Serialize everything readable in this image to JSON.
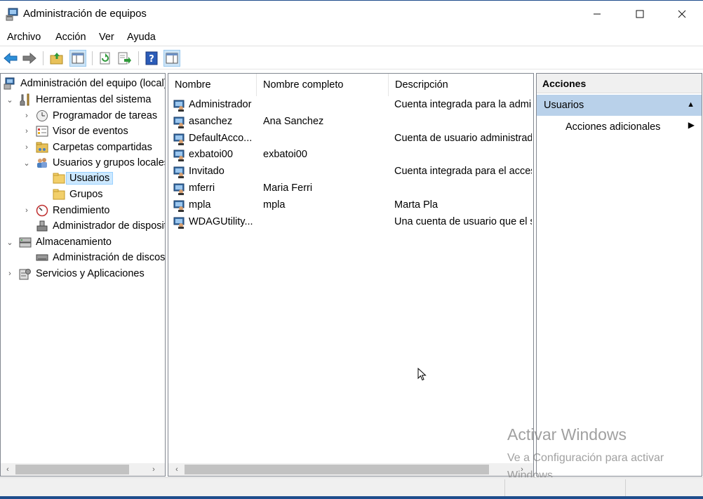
{
  "window": {
    "title": "Administración de equipos",
    "controls": {
      "minimize": "—",
      "maximize": "☐",
      "close": "✕"
    }
  },
  "menu": [
    "Archivo",
    "Acción",
    "Ver",
    "Ayuda"
  ],
  "toolbar": {
    "buttons": [
      "back-icon",
      "forward-icon",
      "up-folder-icon",
      "show-hide-tree-icon",
      "refresh-icon",
      "export-list-icon",
      "help-icon",
      "show-hide-action-pane-icon"
    ]
  },
  "tree": {
    "root": "Administración del equipo (local)",
    "system_tools": "Herramientas del sistema",
    "task_scheduler": "Programador de tareas",
    "event_viewer": "Visor de eventos",
    "shared_folders": "Carpetas compartidas",
    "local_users_groups": "Usuarios y grupos locales",
    "users": "Usuarios",
    "groups": "Grupos",
    "performance": "Rendimiento",
    "device_manager": "Administrador de dispositivos",
    "storage": "Almacenamiento",
    "disk_management": "Administración de discos",
    "services_apps": "Servicios y Aplicaciones"
  },
  "list": {
    "columns": [
      "Nombre",
      "Nombre completo",
      "Descripción"
    ],
    "rows": [
      {
        "name": "Administrador",
        "full_name": "",
        "description": "Cuenta integrada para la administración del equipo o dominio"
      },
      {
        "name": "asanchez",
        "full_name": "Ana Sanchez",
        "description": ""
      },
      {
        "name": "DefaultAcco...",
        "full_name": "",
        "description": "Cuenta de usuario administrada por el sistema."
      },
      {
        "name": "exbatoi00",
        "full_name": "exbatoi00",
        "description": ""
      },
      {
        "name": "Invitado",
        "full_name": "",
        "description": "Cuenta integrada para el acceso como invitado"
      },
      {
        "name": "mferri",
        "full_name": "Maria Ferri",
        "description": ""
      },
      {
        "name": "mpla",
        "full_name": "mpla",
        "description": "Marta Pla"
      },
      {
        "name": "WDAGUtility...",
        "full_name": "",
        "description": "Una cuenta de usuario que el sistema administra"
      }
    ]
  },
  "actions": {
    "header": "Acciones",
    "selected": "Usuarios",
    "more": "Acciones adicionales"
  },
  "watermark": {
    "title": "Activar Windows",
    "subtitle": "Ve a Configuración para activar Windows."
  }
}
